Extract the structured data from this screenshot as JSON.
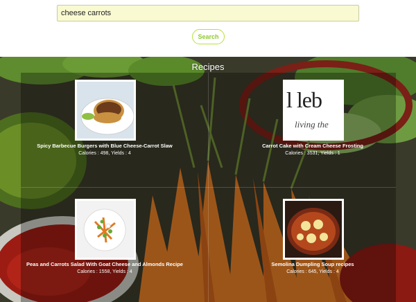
{
  "search": {
    "value": "cheese carrots",
    "button_label": "Search"
  },
  "section": {
    "title": "Recipes"
  },
  "recipes": [
    {
      "title": "Spicy Barbecue Burgers with Blue Cheese-Carrot Slaw",
      "meta": "Calories : 498, Yields : 4",
      "image": "burger-plate-image"
    },
    {
      "title": "Carrot Cake with Cream Cheese Frosting",
      "meta": "Calories : 3531, Yields : 1",
      "image": "blog-logo-image",
      "image_text_1": "l leb",
      "image_text_2": "living the"
    },
    {
      "title": "Peas and Carrots Salad With Goat Cheese and Almonds Recipe",
      "meta": "Calories : 1558, Yields : 4",
      "image": "salad-plate-image"
    },
    {
      "title": "Semolina Dumpling Soup recipes",
      "meta": "Calories : 645, Yields : 4",
      "image": "soup-bowl-image"
    }
  ],
  "colors": {
    "search_bg": "#fafad2",
    "accent": "#8ccb2b"
  }
}
